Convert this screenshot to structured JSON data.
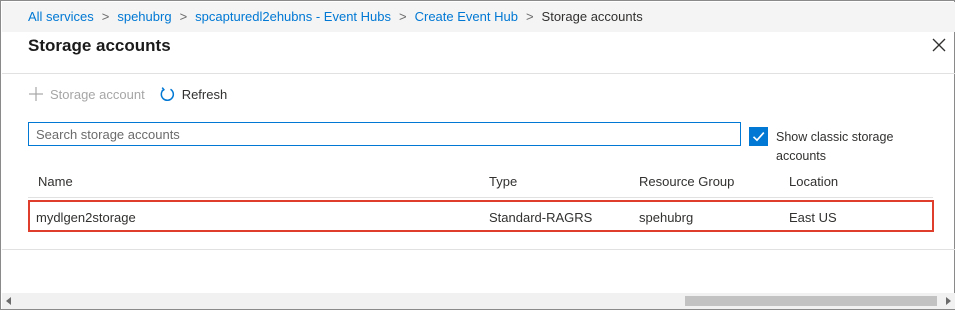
{
  "breadcrumb": {
    "items": [
      "All services",
      "spehubrg",
      "spcapturedl2ehubns - Event Hubs",
      "Create Event Hub"
    ],
    "current": "Storage accounts",
    "separator": ">"
  },
  "panel": {
    "title": "Storage accounts"
  },
  "toolbar": {
    "add_label": "Storage account",
    "refresh_label": "Refresh"
  },
  "search": {
    "placeholder": "Search storage accounts",
    "value": ""
  },
  "classic_toggle": {
    "label": "Show classic storage accounts",
    "checked": true
  },
  "table": {
    "columns": [
      "Name",
      "Type",
      "Resource Group",
      "Location"
    ],
    "rows": [
      [
        "mydlgen2storage",
        "Standard-RAGRS",
        "spehubrg",
        "East US"
      ]
    ]
  },
  "colors": {
    "accent": "#0078d4",
    "highlight_border": "#e03e2d",
    "breadcrumb_bg": "#f4f4f4"
  },
  "icons": [
    "plus-icon",
    "refresh-icon",
    "close-icon",
    "checkmark-icon",
    "chevron-right-icon"
  ]
}
